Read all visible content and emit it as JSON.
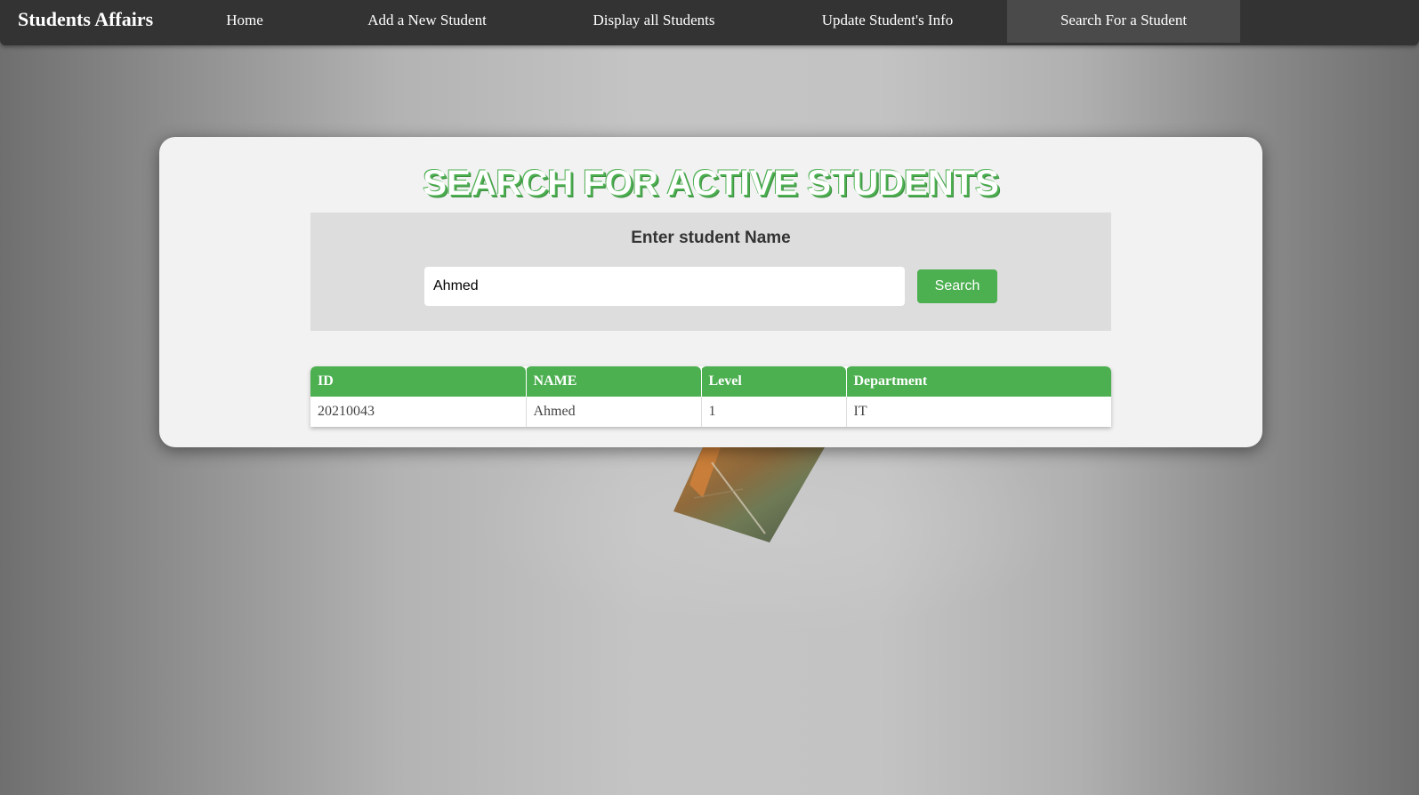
{
  "navbar": {
    "brand": "Students Affairs",
    "items": [
      {
        "label": "Home",
        "active": false
      },
      {
        "label": "Add a New Student",
        "active": false
      },
      {
        "label": "Display all Students",
        "active": false
      },
      {
        "label": "Update Student's Info",
        "active": false
      },
      {
        "label": "Search For a Student",
        "active": true
      }
    ]
  },
  "main": {
    "title": "SEARCH FOR ACTIVE STUDENTS",
    "search": {
      "label": "Enter student Name",
      "value": "Ahmed",
      "button_label": "Search"
    },
    "table": {
      "columns": [
        "ID",
        "NAME",
        "Level",
        "Department"
      ],
      "rows": [
        [
          "20210043",
          "Ahmed",
          "1",
          "IT"
        ]
      ]
    }
  },
  "colors": {
    "accent": "#4caf50",
    "navbar_bg": "#333333",
    "navbar_active_bg": "#4a4a4a",
    "card_bg": "#f2f2f2",
    "panel_bg": "#dddddd"
  }
}
